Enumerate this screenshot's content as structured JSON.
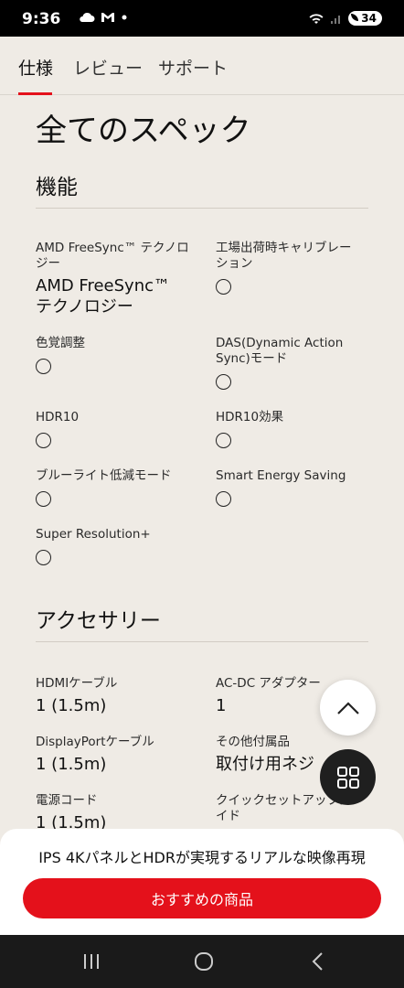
{
  "status_bar": {
    "time": "9:36",
    "battery": "34",
    "icons_left": [
      "cloud-icon",
      "gmail-icon",
      "dot-icon"
    ],
    "icons_right": [
      "wifi-icon",
      "signal-icon",
      "battery-icon"
    ]
  },
  "tabs": [
    {
      "label": "仕様",
      "active": true
    },
    {
      "label": "レビュー",
      "active": false
    },
    {
      "label": "サポート",
      "active": false
    }
  ],
  "page_title": "全てのスペック",
  "sections": {
    "features": {
      "title": "機能",
      "items": [
        {
          "label": "AMD FreeSync™ テクノロジー",
          "value": "AMD FreeSync™ テクノロジー"
        },
        {
          "label": "工場出荷時キャリブレーション",
          "value": "radio"
        },
        {
          "label": "色覚調整",
          "value": "radio"
        },
        {
          "label": "DAS(Dynamic Action Sync)モード",
          "value": "radio"
        },
        {
          "label": "HDR10",
          "value": "radio"
        },
        {
          "label": "HDR10効果",
          "value": "radio"
        },
        {
          "label": "ブルーライト低減モード",
          "value": "radio"
        },
        {
          "label": "Smart Energy Saving",
          "value": "radio"
        },
        {
          "label": "Super Resolution+",
          "value": "radio"
        }
      ]
    },
    "accessories": {
      "title": "アクセサリー",
      "items": [
        {
          "label": "HDMIケーブル",
          "value": "1 (1.5m)"
        },
        {
          "label": "AC-DC アダプター",
          "value": "1"
        },
        {
          "label": "DisplayPortケーブル",
          "value": "1 (1.5m)"
        },
        {
          "label": "その他付属品",
          "value": "取付け用ネジ"
        },
        {
          "label": "電源コード",
          "value": "1 (1.5m)"
        },
        {
          "label": "クイックセットアップガイド",
          "value": ""
        }
      ]
    }
  },
  "promo": {
    "text": "IPS 4KパネルとHDRが実現するリアルな映像再現",
    "button_label": "おすすめの商品"
  },
  "colors": {
    "accent": "#e4111b",
    "background": "#efebe5"
  }
}
